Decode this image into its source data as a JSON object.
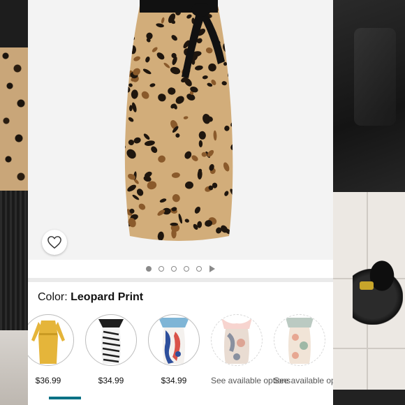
{
  "product": {
    "color_label_prefix": "Color: ",
    "color_value": "Leopard Print"
  },
  "gallery": {
    "dot_count": 6,
    "active_index": 0
  },
  "swatches": [
    {
      "kind": "price",
      "text": "$36.99",
      "color": "#e5b53a"
    },
    {
      "kind": "price",
      "text": "$34.99",
      "color": "#1e1e1e"
    },
    {
      "kind": "price",
      "text": "$34.99",
      "color": "#7fb5d6"
    },
    {
      "kind": "avail",
      "text": "See available options",
      "color": "#f3b8b0"
    },
    {
      "kind": "avail",
      "text": "See available options",
      "color": "#8fa79a"
    }
  ],
  "colors": {
    "accent": "#007185",
    "leopard_base": "#d2ad7a",
    "leopard_spot": "#1f160e"
  }
}
